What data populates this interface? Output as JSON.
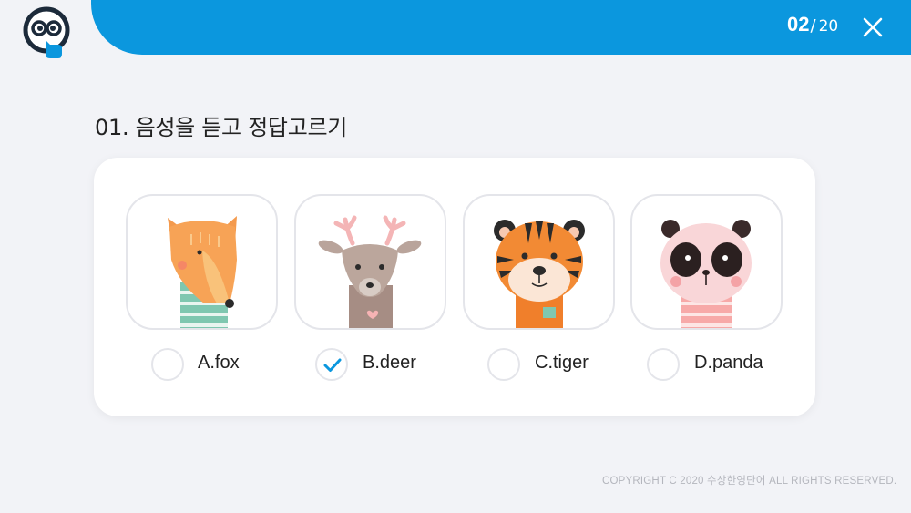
{
  "header": {
    "logo_icon": "owl-face-icon",
    "counter_current": "02",
    "counter_separator": "/",
    "counter_total": "20",
    "close_icon": "close-icon",
    "accent_color": "#0b97de"
  },
  "question": {
    "title": "01. 음성을 듣고 정답고르기"
  },
  "options": [
    {
      "label": "A.fox",
      "icon": "fox-illustration",
      "selected": false
    },
    {
      "label": "B.deer",
      "icon": "deer-illustration",
      "selected": true
    },
    {
      "label": "C.tiger",
      "icon": "tiger-illustration",
      "selected": false
    },
    {
      "label": "D.panda",
      "icon": "panda-illustration",
      "selected": false
    }
  ],
  "footer": {
    "copyright": "COPYRIGHT C 2020 수상한영단어 ALL RIGHTS RESERVED."
  }
}
